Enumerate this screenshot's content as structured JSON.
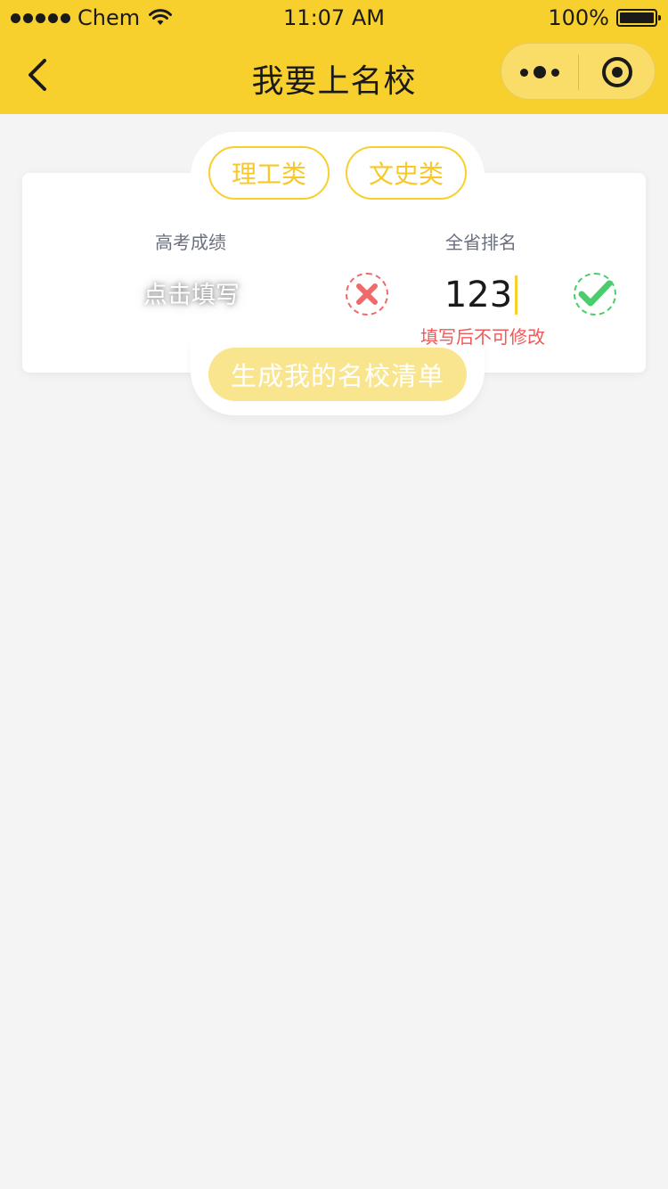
{
  "status_bar": {
    "carrier": "Chem",
    "time": "11:07 AM",
    "battery": "100%",
    "signal_icon": "signal-dots-icon",
    "wifi_icon": "wifi-icon",
    "battery_icon": "battery-icon"
  },
  "nav": {
    "title": "我要上名校",
    "back_icon": "chevron-left-icon",
    "more_icon": "more-dots-icon",
    "close_icon": "target-close-icon"
  },
  "tabs": [
    {
      "label": "理工类"
    },
    {
      "label": "文史类"
    }
  ],
  "form": {
    "score_label": "高考成绩",
    "score_placeholder": "点击填写",
    "rank_label": "全省排名",
    "rank_value": "123",
    "hint": "填写后不可修改"
  },
  "generate_label": "生成我的名校清单",
  "colors": {
    "brand": "#f8d02e",
    "error": "#f06a6a",
    "success": "#4ccd6d",
    "background": "#f4f4f4"
  }
}
